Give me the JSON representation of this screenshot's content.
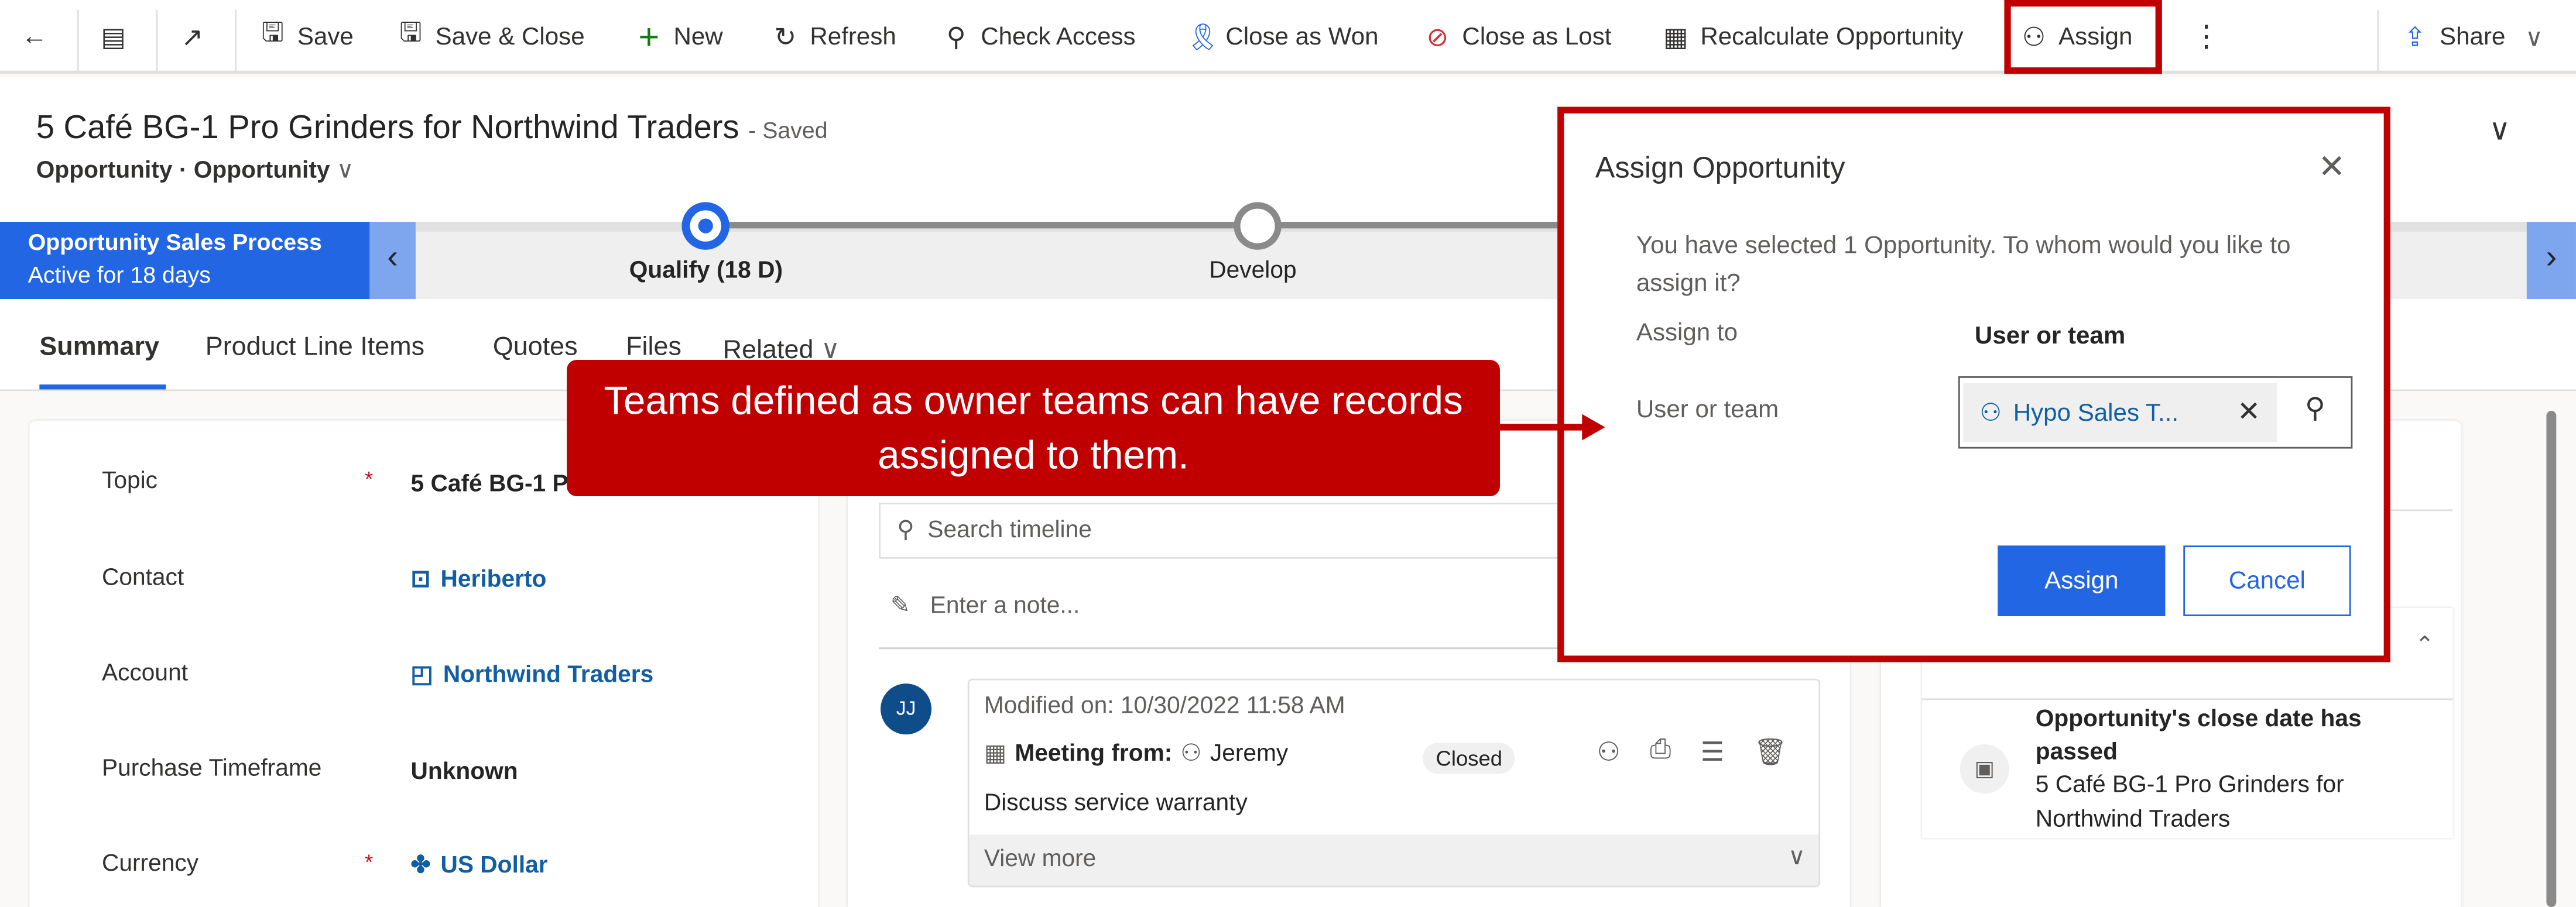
{
  "toolbar": {
    "items": [
      {
        "label": "Save",
        "icon": "save-icon"
      },
      {
        "label": "Save & Close",
        "icon": "save-close-icon"
      },
      {
        "label": "New",
        "icon": "plus-icon"
      },
      {
        "label": "Refresh",
        "icon": "refresh-icon"
      },
      {
        "label": "Check Access",
        "icon": "key-icon"
      },
      {
        "label": "Close as Won",
        "icon": "ribbon-icon"
      },
      {
        "label": "Close as Lost",
        "icon": "prohibited-icon"
      },
      {
        "label": "Recalculate Opportunity",
        "icon": "calculator-icon"
      },
      {
        "label": "Assign",
        "icon": "person-arrow-icon"
      }
    ],
    "share": "Share"
  },
  "header": {
    "title": "5 Café BG-1 Pro Grinders for Northwind Traders",
    "status": "- Saved",
    "entity": "Opportunity",
    "form": "Opportunity"
  },
  "bpf": {
    "name": "Opportunity Sales Process",
    "duration": "Active for 18 days",
    "stages": [
      {
        "label": "Qualify  (18 D)",
        "active": true
      },
      {
        "label": "Develop",
        "active": false
      }
    ]
  },
  "tabs": [
    "Summary",
    "Product Line Items",
    "Quotes",
    "Files",
    "Related"
  ],
  "fields": [
    {
      "label": "Topic",
      "required": true,
      "value": "5 Café BG-1 Pro Grinders for Northwind Traders",
      "icon": ""
    },
    {
      "label": "Contact",
      "required": false,
      "value": "Heriberto",
      "icon": "contact-icon",
      "link": true
    },
    {
      "label": "Account",
      "required": false,
      "value": "Northwind Traders",
      "icon": "account-icon",
      "link": true
    },
    {
      "label": "Purchase Timeframe",
      "required": false,
      "value": "Unknown",
      "icon": ""
    },
    {
      "label": "Currency",
      "required": true,
      "value": "US Dollar",
      "icon": "currency-icon",
      "link": true
    }
  ],
  "timeline": {
    "search_placeholder": "Search timeline",
    "note_placeholder": "Enter a note...",
    "activity": {
      "avatar": "JJ",
      "modified": "Modified on: 10/30/2022 11:58 AM",
      "type": "Meeting from:",
      "from": "Jeremy",
      "status": "Closed",
      "description": "Discuss service warranty",
      "view_more": "View more"
    }
  },
  "assistant": {
    "title": "Opportunity's close date has passed",
    "subtitle": "5 Café BG-1 Pro Grinders for Northwind Traders"
  },
  "dialog": {
    "title": "Assign Opportunity",
    "message": "You have selected 1 Opportunity. To whom would you like to assign it?",
    "assign_to_label": "Assign to",
    "assign_to_value": "User or team",
    "user_label": "User or team",
    "user_value": "Hypo Sales T...",
    "assign_button": "Assign",
    "cancel_button": "Cancel"
  },
  "callout": {
    "text": "Teams defined as owner teams can have records assigned to them."
  },
  "colors": {
    "accent": "#2266e3",
    "annotation": "#c00000",
    "link": "#115ea3"
  }
}
